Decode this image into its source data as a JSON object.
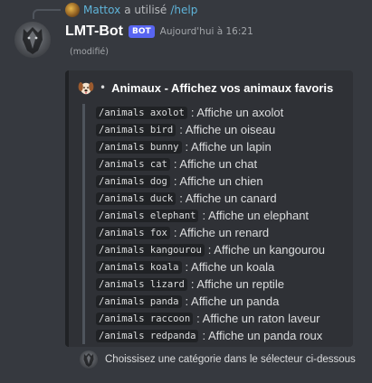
{
  "reply": {
    "username": "Mattox",
    "text": "a utilisé",
    "command": "/help"
  },
  "message": {
    "username": "LMT-Bot",
    "badge": "BOT",
    "timestamp": "Aujourd'hui à 16:21",
    "edited": "(modifié)"
  },
  "embed": {
    "icon": "dog-face-icon",
    "bullet": "•",
    "title": "Animaux - Affichez vos animaux favoris",
    "commands": [
      {
        "cmd": "/animals axolot",
        "desc": ": Affiche un axolot"
      },
      {
        "cmd": "/animals bird",
        "desc": ": Affiche un oiseau"
      },
      {
        "cmd": "/animals bunny",
        "desc": ": Affiche un lapin"
      },
      {
        "cmd": "/animals cat",
        "desc": ": Affiche un chat"
      },
      {
        "cmd": "/animals dog",
        "desc": ": Affiche un chien"
      },
      {
        "cmd": "/animals duck",
        "desc": ": Affiche un canard"
      },
      {
        "cmd": "/animals elephant",
        "desc": ": Affiche un elephant"
      },
      {
        "cmd": "/animals fox",
        "desc": ": Affiche un renard"
      },
      {
        "cmd": "/animals kangourou",
        "desc": ": Affiche un kangourou"
      },
      {
        "cmd": "/animals koala",
        "desc": ": Affiche un koala"
      },
      {
        "cmd": "/animals lizard",
        "desc": ": Affiche un reptile"
      },
      {
        "cmd": "/animals panda",
        "desc": ": Affiche un panda"
      },
      {
        "cmd": "/animals raccoon",
        "desc": ": Affiche un raton laveur"
      },
      {
        "cmd": "/animals redpanda",
        "desc": ": Affiche un panda roux"
      }
    ],
    "footer": "Choissisez une catégorie dans le sélecteur ci-dessous"
  },
  "colors": {
    "background": "#36393f",
    "embed_background": "#2f3136",
    "embed_border": "#202225",
    "bot_badge": "#5865f2",
    "link": "#5fb4d9"
  }
}
